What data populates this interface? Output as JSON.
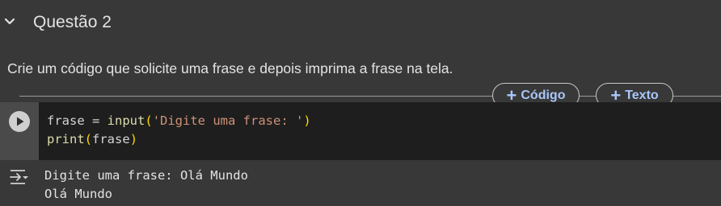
{
  "section": {
    "title": "Questão 2",
    "collapse_icon": "chevron-down-icon"
  },
  "text_cell": {
    "content": "Crie um código que solicite uma frase e depois imprima a frase na tela."
  },
  "toolbar": {
    "add_code_label": "Código",
    "add_text_label": "Texto",
    "plus_glyph": "+"
  },
  "code_cell": {
    "run_icon": "play-icon",
    "line1": {
      "var": "frase",
      "op": " = ",
      "fn": "input",
      "open": "(",
      "str": "'Digite uma frase: '",
      "close": ")"
    },
    "line2": {
      "fn": "print",
      "open": "(",
      "arg": "frase",
      "close": ")"
    }
  },
  "output": {
    "icon": "output-toggle-icon",
    "lines": [
      "Digite uma frase: Olá Mundo",
      "Olá Mundo"
    ]
  },
  "colors": {
    "background": "#383838",
    "editor_background": "#1e1e1e",
    "gutter": "#4a4a4a",
    "accent": "#a8c7fa",
    "string": "#ce9178",
    "function": "#dcdcaa",
    "bracket": "#ffd700"
  }
}
